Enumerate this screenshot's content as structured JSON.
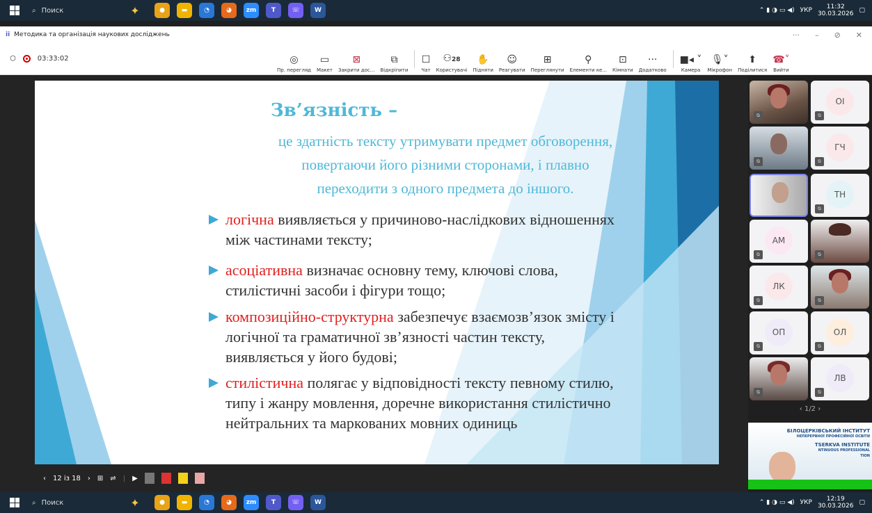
{
  "taskbar_top": {
    "search": "Поиск",
    "lang": "УКР",
    "time": "11:32",
    "date": "30.03.2026"
  },
  "taskbar_bottom": {
    "search": "Поиск",
    "lang": "УКР",
    "time": "12:19",
    "date": "30.03.2026"
  },
  "window": {
    "title": "Методика та організація наукових досліджень"
  },
  "meeting": {
    "timer": "03:33:02"
  },
  "toolbar": {
    "items": [
      {
        "label": "Пр. перегляд",
        "icon": "eye-icon"
      },
      {
        "label": "Макет",
        "icon": "layout-icon"
      },
      {
        "label": "Закрити дос...",
        "icon": "close-share-icon"
      },
      {
        "label": "Відкріпити",
        "icon": "unpin-icon"
      },
      {
        "label": "Чат",
        "icon": "chat-icon"
      },
      {
        "label": "Користувачі",
        "icon": "people-icon",
        "count": "28"
      },
      {
        "label": "Підняти",
        "icon": "hand-icon"
      },
      {
        "label": "Реагувати",
        "icon": "smile-icon"
      },
      {
        "label": "Переглянути",
        "icon": "view-icon"
      },
      {
        "label": "Елементи ке...",
        "icon": "controls-icon"
      },
      {
        "label": "Кімнати",
        "icon": "rooms-icon"
      },
      {
        "label": "Додатково",
        "icon": "more-icon"
      },
      {
        "label": "Камера",
        "icon": "camera-icon"
      },
      {
        "label": "Мікрофон",
        "icon": "mic-icon"
      },
      {
        "label": "Поділитися",
        "icon": "share-icon"
      },
      {
        "label": "Вийти",
        "icon": "leave-icon"
      }
    ]
  },
  "slide": {
    "title": "Зв’язність –",
    "subtitle": [
      "це здатність тексту утримувати предмет обговорення,",
      "повертаючи його різними сторонами, і плавно",
      "переходити з одного предмета до іншого."
    ],
    "bullets": [
      {
        "kw": "логічна",
        "rest": " виявляється у причиново-наслідкових відношеннях між частинами тексту;"
      },
      {
        "kw": "асоціативна",
        "rest": " визначає основну тему, ключові слова, стилістичні засоби і фігури тощо;"
      },
      {
        "kw": "композиційно-структурна",
        "rest": " забезпечує взаємозв’язок змісту і логічної та граматичної зв’язності частин тексту, виявляється у його будові;"
      },
      {
        "kw": "стилістична",
        "rest": " полягає у відповідності тексту певному стилю, типу і жанру мовлення, доречне використання стилістично нейтральних та маркованих мовних одиниць"
      }
    ]
  },
  "slide_nav": {
    "page": "12 із 18"
  },
  "participants": [
    "ОІ",
    "ГЧ",
    "ТН",
    "АМ",
    "ЛК",
    "ОП",
    "ОЛ",
    "ЛВ"
  ],
  "pager": "1/2",
  "banner": {
    "line1": "БІЛОЦЕРКІВСЬКИЙ ІНСТИТУТ",
    "line2": "НЕПЕРЕРВНОЇ ПРОФЕСІЙНОЇ ОСВІТИ",
    "line3": "TSERKVA INSTITUTE",
    "line4": "NTINUOUS PROFESSIONAL",
    "line5": "TION"
  }
}
